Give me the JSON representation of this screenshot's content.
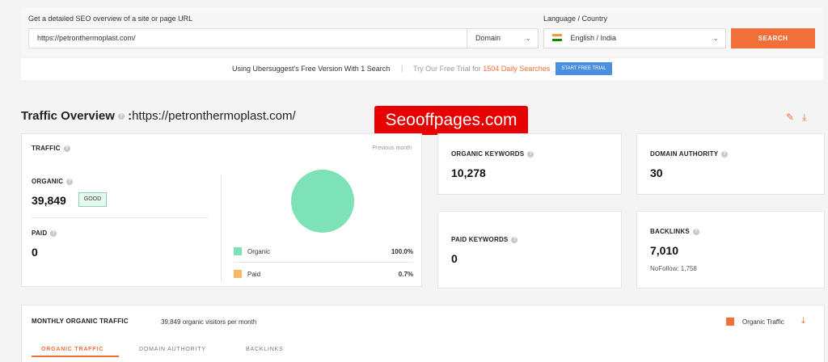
{
  "search": {
    "label": "Get a detailed SEO overview of a site or page URL",
    "url_value": "https://petronthermoplast.com/",
    "domain_option": "Domain",
    "lang_label": "Language / Country",
    "lang_value": "English / India",
    "button": "SEARCH"
  },
  "free_bar": {
    "text": "Using Ubersuggest's Free Version With 1 Search",
    "separator": "|",
    "trial_prefix": "Try Our Free Trial for",
    "trial_highlight": "1504 Daily Searches",
    "trial_button": "START FREE TRIAL"
  },
  "overview": {
    "title": "Traffic Overview",
    "colon": ":",
    "url": "https://petronthermoplast.com/",
    "info": "?"
  },
  "watermark": "Seooffpages.com",
  "traffic": {
    "label": "TRAFFIC",
    "period": "Previous month",
    "organic_label": "ORGANIC",
    "organic_value": "39,849",
    "badge": "GOOD",
    "paid_label": "PAID",
    "paid_value": "0",
    "legend": [
      {
        "name": "Organic",
        "pct": "100.0%",
        "color": "#7de2b7"
      },
      {
        "name": "Paid",
        "pct": "0.7%",
        "color": "#f5b961"
      }
    ]
  },
  "organic_keywords": {
    "label": "ORGANIC KEYWORDS",
    "value": "10,278"
  },
  "domain_authority": {
    "label": "DOMAIN AUTHORITY",
    "value": "30"
  },
  "paid_keywords": {
    "label": "PAID KEYWORDS",
    "value": "0"
  },
  "backlinks": {
    "label": "BACKLINKS",
    "value": "7,010",
    "nofollow": "NoFollow: 1,758"
  },
  "monthly": {
    "title": "MONTHLY ORGANIC TRAFFIC",
    "subtitle": "39,849 organic visitors per month",
    "legend": "Organic Traffic",
    "tabs": [
      "ORGANIC TRAFFIC",
      "DOMAIN AUTHORITY",
      "BACKLINKS"
    ]
  },
  "colors": {
    "accent": "#f26f3a",
    "organic": "#7de2b7",
    "paid": "#f5b961",
    "trial": "#4a90e2"
  },
  "icons": [
    "chevron-down-icon",
    "india-flag-icon",
    "info-icon",
    "edit-icon",
    "download-icon"
  ]
}
